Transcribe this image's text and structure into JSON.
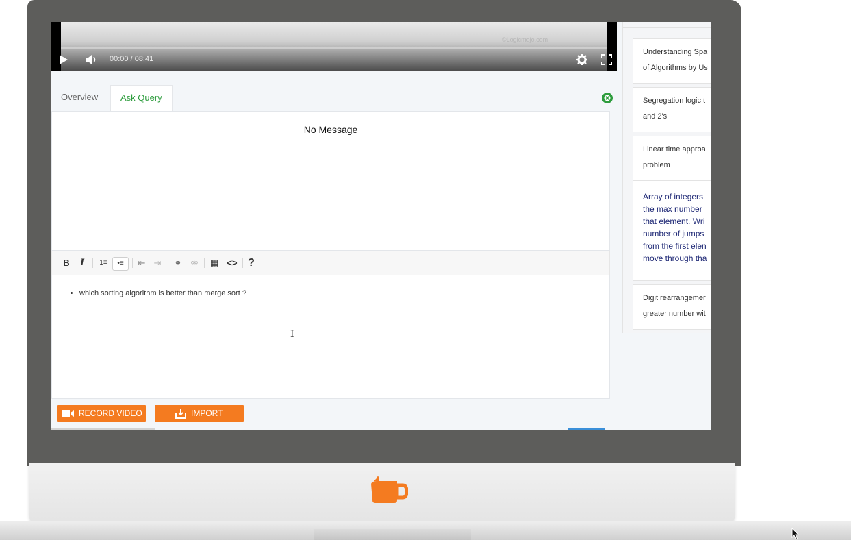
{
  "video": {
    "watermark": "©Logicmojo.com",
    "time": "00:00 / 08:41",
    "progress": 0
  },
  "tabs": [
    {
      "label": "Overview",
      "active": false
    },
    {
      "label": "Ask Query",
      "active": true
    }
  ],
  "messages": {
    "empty_text": "No Message"
  },
  "editor": {
    "toolbar": [
      {
        "name": "bold",
        "glyph": "B"
      },
      {
        "name": "italic",
        "glyph": "I"
      },
      {
        "name": "ordered-list",
        "glyph": "1≡"
      },
      {
        "name": "bullet-list",
        "glyph": "•≡",
        "active": true
      },
      {
        "name": "outdent",
        "glyph": "⇤"
      },
      {
        "name": "indent",
        "glyph": "⇥"
      },
      {
        "name": "link",
        "glyph": "⚭"
      },
      {
        "name": "unlink",
        "glyph": "⚮"
      },
      {
        "name": "table",
        "glyph": "▦"
      },
      {
        "name": "code",
        "glyph": "<>"
      },
      {
        "name": "help",
        "glyph": "?"
      }
    ],
    "content": [
      "which sorting algorithm is better than merge sort ?"
    ]
  },
  "actions": {
    "record_label": "RECORD VIDEO",
    "import_label": "IMPORT"
  },
  "sidebar": {
    "items": [
      {
        "text": "Understanding Spa\nof Algorithms by Us",
        "highlight": false
      },
      {
        "text": "Segregation logic t\nand 2's",
        "highlight": false
      },
      {
        "text": "Linear time approa\nproblem",
        "highlight": false
      },
      {
        "text": "Array of integers \nthe max number \nthat element. Wri\nnumber of jumps\nfrom the first elen\nmove through tha",
        "highlight": true
      },
      {
        "text": "Digit rearrangemer\ngreater number wit",
        "highlight": false
      }
    ]
  },
  "colors": {
    "accent_green": "#2e9d3e",
    "button_orange": "#f47b20",
    "bezel": "#5d5d5b"
  }
}
